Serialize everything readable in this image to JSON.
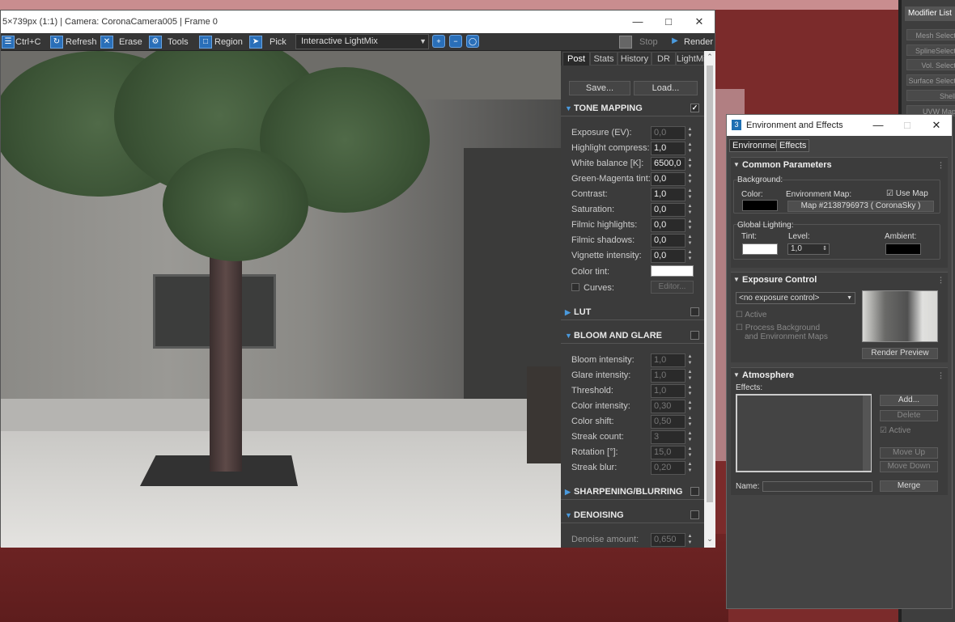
{
  "vfb": {
    "title": "5×739px (1:1) | Camera: CoronaCamera005 | Frame 0",
    "toolbar": {
      "copy": "Ctrl+C",
      "refresh": "Refresh",
      "erase": "Erase",
      "tools": "Tools",
      "region": "Region",
      "pick": "Pick",
      "lightmix": "Interactive LightMix",
      "stop": "Stop",
      "render": "Render"
    },
    "tabs": [
      "Post",
      "Stats",
      "History",
      "DR",
      "LightMix"
    ],
    "save": "Save...",
    "load": "Load...",
    "sections": {
      "tone": "TONE MAPPING",
      "lut": "LUT",
      "bloom": "BLOOM AND GLARE",
      "sharpen": "SHARPENING/BLURRING",
      "denoise": "DENOISING"
    },
    "tone_rows": [
      {
        "label": "Exposure (EV):",
        "value": "0,0"
      },
      {
        "label": "Highlight compress:",
        "value": "1,0"
      },
      {
        "label": "White balance [K]:",
        "value": "6500,0"
      },
      {
        "label": "Green-Magenta tint:",
        "value": "0,0"
      },
      {
        "label": "Contrast:",
        "value": "1,0"
      },
      {
        "label": "Saturation:",
        "value": "0,0"
      },
      {
        "label": "Filmic highlights:",
        "value": "0,0"
      },
      {
        "label": "Filmic shadows:",
        "value": "0,0"
      },
      {
        "label": "Vignette intensity:",
        "value": "0,0"
      }
    ],
    "color_tint": "Color tint:",
    "curves": "Curves:",
    "editor": "Editor...",
    "bloom_rows": [
      {
        "label": "Bloom intensity:",
        "value": "1,0"
      },
      {
        "label": "Glare intensity:",
        "value": "1,0"
      },
      {
        "label": "Threshold:",
        "value": "1,0"
      },
      {
        "label": "Color intensity:",
        "value": "0,30"
      },
      {
        "label": "Color shift:",
        "value": "0,50"
      },
      {
        "label": "Streak count:",
        "value": "3"
      },
      {
        "label": "Rotation [°]:",
        "value": "15,0"
      },
      {
        "label": "Streak blur:",
        "value": "0,20"
      }
    ],
    "denoise_label": "Denoise amount:",
    "denoise_value": "0,650"
  },
  "command_panel": {
    "header": "Modifier List",
    "items": [
      "Mesh Select",
      "SplineSelect",
      "Vol. Select",
      "Surface Select",
      "Shell",
      "UVW Map"
    ]
  },
  "env": {
    "title": "Environment and Effects",
    "app_icon": "3",
    "tabs": [
      "Environment",
      "Effects"
    ],
    "common": {
      "title": "Common Parameters",
      "background": "Background:",
      "color": "Color:",
      "env_map": "Environment Map:",
      "use_map": "Use Map",
      "map_button": "Map #2138796973  ( CoronaSky )",
      "global_lighting": "Global Lighting:",
      "tint": "Tint:",
      "level": "Level:",
      "level_value": "1,0",
      "ambient": "Ambient:"
    },
    "exposure": {
      "title": "Exposure Control",
      "dropdown": "<no exposure control>",
      "active": "Active",
      "process_bg_1": "Process Background",
      "process_bg_2": "and Environment Maps",
      "render_preview": "Render Preview"
    },
    "atmosphere": {
      "title": "Atmosphere",
      "effects": "Effects:",
      "add": "Add...",
      "delete": "Delete",
      "active": "Active",
      "move_up": "Move Up",
      "move_down": "Move Down",
      "name": "Name:",
      "merge": "Merge"
    }
  }
}
